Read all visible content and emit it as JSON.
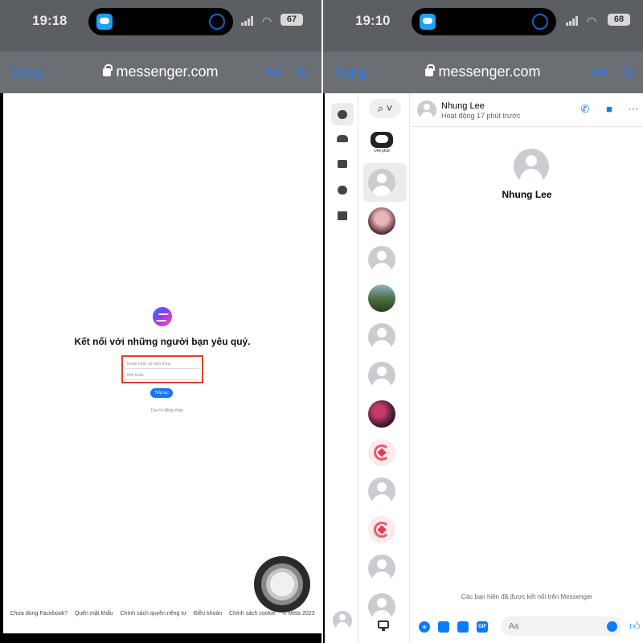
{
  "left": {
    "status": {
      "time": "19:18",
      "battery": "67"
    },
    "browser": {
      "done_label": "Xong",
      "url": "messenger.com",
      "text_size_label": "AA"
    },
    "login": {
      "tagline": "Kết nối với những người bạn yêu quý.",
      "email_placeholder": "Email hoặc số điện thoại",
      "password_placeholder": "Mật khẩu",
      "continue_label": "Tiếp tục",
      "keep_signed_in": "Duy trì đăng nhập"
    },
    "footer": [
      "Chưa dùng Facebook?",
      "Quên mật khẩu",
      "Chính sách quyền riêng tư",
      "Điều khoản",
      "Chính sách cookie",
      "© Meta 2023"
    ]
  },
  "right": {
    "status": {
      "time": "19:10",
      "battery": "68"
    },
    "browser": {
      "done_label": "Xong",
      "url": "messenger.com",
      "text_size_label": "AA"
    },
    "rail_icons": [
      "chat-bubble-icon",
      "people-icon",
      "store-icon",
      "message-requests-icon",
      "archive-icon"
    ],
    "chat_list": {
      "search_icon": "search-icon",
      "first_item_caption": "140 phút"
    },
    "conversation": {
      "contact_name": "Nhung Lee",
      "contact_status": "Hoạt động 17 phút trước",
      "profile_name": "Nhung Lee",
      "connected_note": "Các bạn hiện đã được kết nối trên Messenger",
      "input_placeholder": "Aa",
      "gif_label": "GIF"
    }
  }
}
